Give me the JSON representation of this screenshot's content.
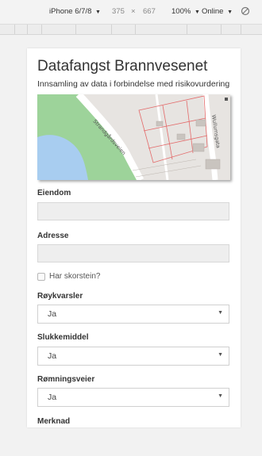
{
  "devtools": {
    "device": "iPhone 6/7/8",
    "width": "375",
    "times": "×",
    "height": "667",
    "zoom": "100%",
    "network": "Online",
    "caret": "▼"
  },
  "page": {
    "title": "Datafangst Brannvesenet",
    "subtitle": "Innsamling av data i forbindelse med risikovurdering"
  },
  "map": {
    "road_label": "Strandgårdsveien",
    "street_label": "Wullumsgata"
  },
  "form": {
    "eiendom": {
      "label": "Eiendom",
      "value": ""
    },
    "adresse": {
      "label": "Adresse",
      "value": ""
    },
    "skorstein": {
      "label": "Har skorstein?",
      "checked": false
    },
    "roykvarsler": {
      "label": "Røykvarsler",
      "value": "Ja",
      "options": [
        "Ja"
      ]
    },
    "slukkemiddel": {
      "label": "Slukkemiddel",
      "value": "Ja",
      "options": [
        "Ja"
      ]
    },
    "romningsveier": {
      "label": "Rømningsveier",
      "value": "Ja",
      "options": [
        "Ja"
      ]
    },
    "merknad": {
      "label": "Merknad"
    }
  },
  "select_caret": "▼",
  "colors": {
    "water": "#a8cdf0",
    "park": "#9dd39a",
    "land": "#e7e4e1",
    "road": "#ffffff",
    "parcel_line": "#e36a6a"
  }
}
